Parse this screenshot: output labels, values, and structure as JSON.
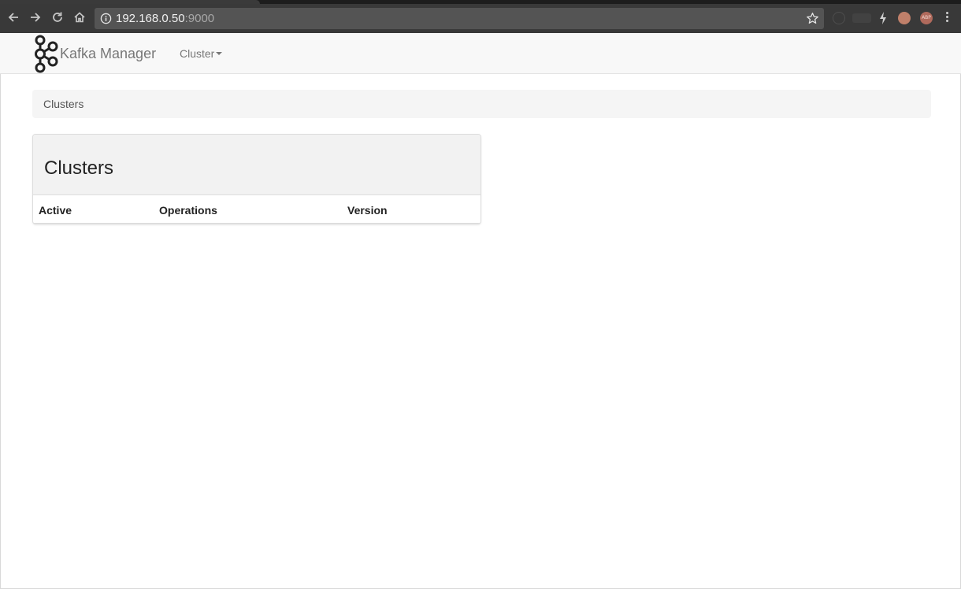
{
  "browser": {
    "url_host": "192.168.0.50",
    "url_port": ":9000",
    "extensions": {
      "abp_label": "ABP"
    },
    "icons": [
      "back-icon",
      "forward-icon",
      "reload-icon",
      "home-icon",
      "info-icon",
      "star-icon",
      "bolt-icon",
      "menu-icon"
    ]
  },
  "navbar": {
    "brand_name": "Kafka Manager",
    "dropdown_label": "Cluster"
  },
  "breadcrumb": {
    "current": "Clusters"
  },
  "panel": {
    "title": "Clusters",
    "columns": [
      "Active",
      "Operations",
      "Version"
    ],
    "rows": []
  },
  "colors": {
    "navbar_bg": "#f8f8f8",
    "panel_heading_bg": "#f2f2f2",
    "breadcrumb_bg": "#f5f5f5",
    "chrome_bg": "#393939"
  }
}
